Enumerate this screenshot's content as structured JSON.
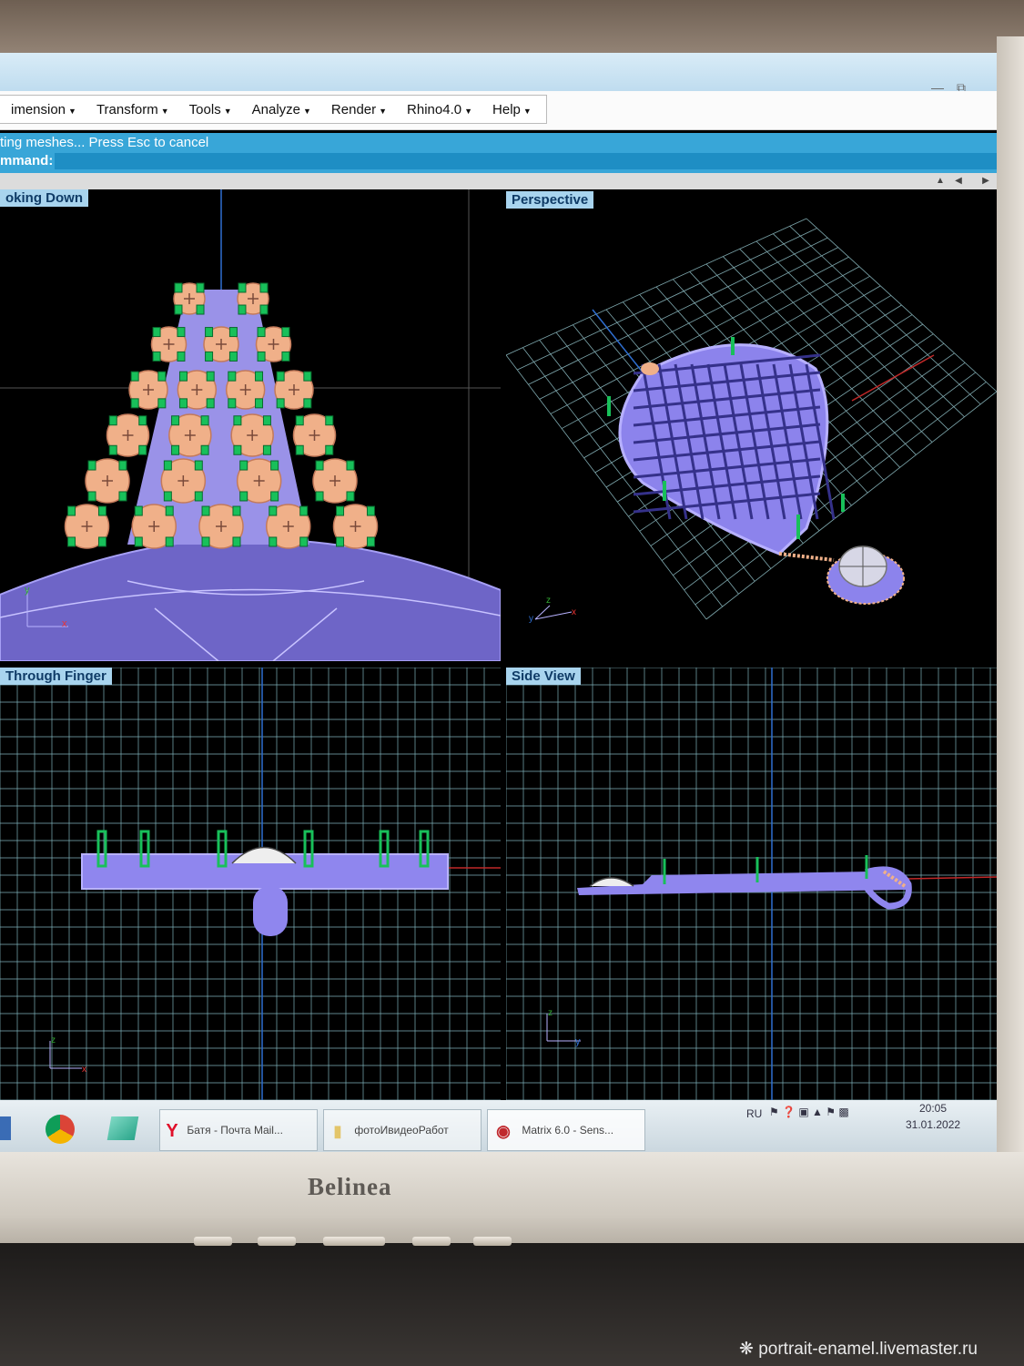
{
  "monitor": {
    "brand": "Belinea"
  },
  "watermark": "portrait-enamel.livemaster.ru",
  "window": {
    "controls": {
      "minimize": "—",
      "restore": "⧉",
      "close": "✕"
    }
  },
  "menu": {
    "items": [
      {
        "label": "imension"
      },
      {
        "label": "Transform"
      },
      {
        "label": "Tools"
      },
      {
        "label": "Analyze"
      },
      {
        "label": "Render"
      },
      {
        "label": "Rhino4.0"
      },
      {
        "label": "Help"
      }
    ]
  },
  "command": {
    "status_line": "ting meshes... Press Esc to cancel",
    "prompt": "mmand:",
    "value": ""
  },
  "viewports": [
    {
      "label": "oking Down"
    },
    {
      "label": "Perspective"
    },
    {
      "label": "Through Finger"
    },
    {
      "label": "Side View"
    }
  ],
  "axes": {
    "x": "x",
    "y": "y",
    "z": "z"
  },
  "taskbar": {
    "items": [
      {
        "label": "Батя - Почта Mail..."
      },
      {
        "label": "фотоИвидеоРабот"
      },
      {
        "label": "Matrix 6.0 - Sens..."
      }
    ],
    "tray": {
      "language": "RU",
      "time": "20:05",
      "date": "31.01.2022"
    }
  },
  "colors": {
    "model": "#8f86ee",
    "grid": "#8fb7bf",
    "gem": "#f0b089",
    "prong": "#18c05a",
    "accent": "#38a6d8"
  }
}
